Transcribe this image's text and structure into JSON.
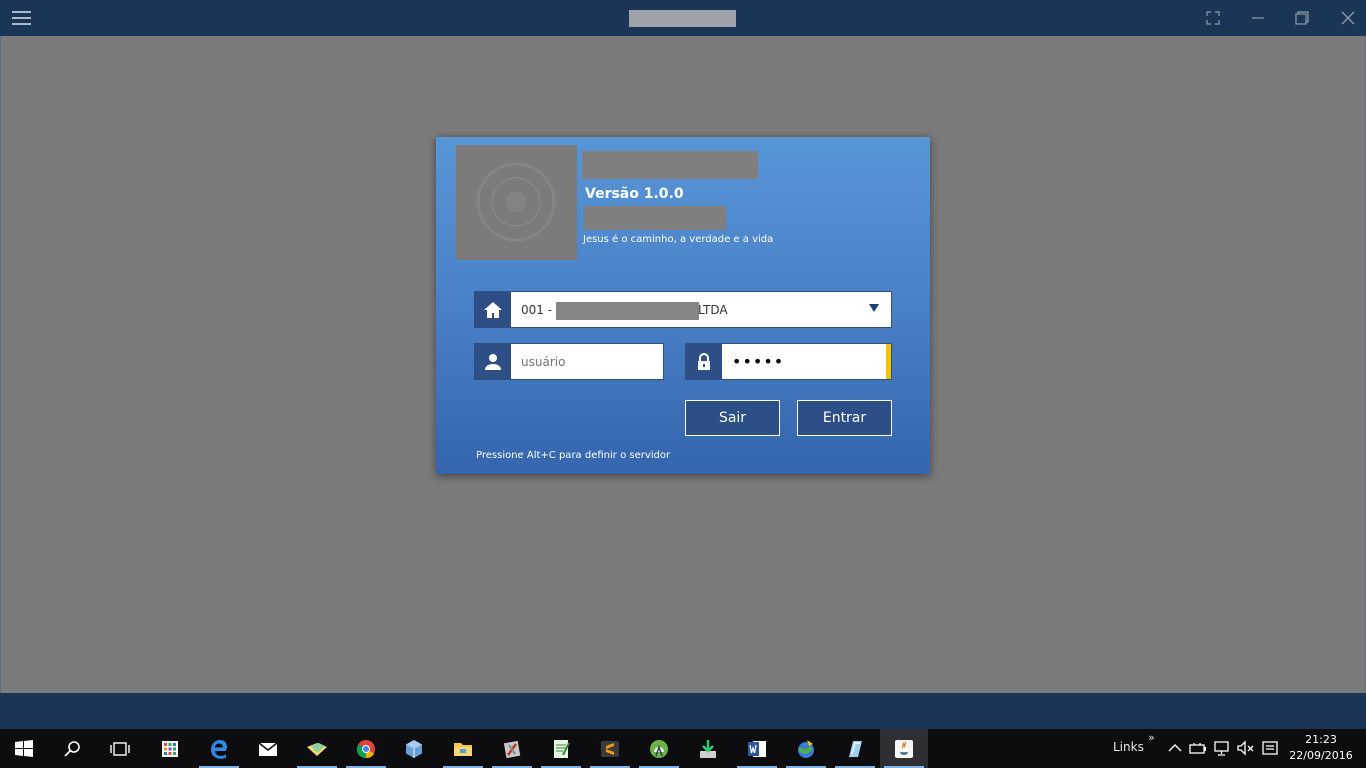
{
  "window": {
    "menu_icon": "hamburger-menu-icon",
    "controls": [
      "fullscreen-icon",
      "minimize-icon",
      "restore-icon",
      "close-icon"
    ]
  },
  "login": {
    "version": "Versão 1.0.0",
    "motto": "Jesus é o caminho, a verdade e a vida",
    "company_prefix": "001 -",
    "company_suffix": "LTDA",
    "user_placeholder": "usuário",
    "password_value": "•••••",
    "exit_label": "Sair",
    "enter_label": "Entrar",
    "hint": "Pressione Alt+C para definir o servidor"
  },
  "taskbar": {
    "apps": [
      "start",
      "search",
      "task-view",
      "store",
      "edge",
      "mail",
      "explorer-stack",
      "chrome",
      "virtualbox",
      "file-explorer",
      "tools",
      "notepad",
      "sublime",
      "android-studio",
      "downloader",
      "word",
      "network-app",
      "cloud-app",
      "java"
    ],
    "links_label": "Links",
    "chevron": "»",
    "time": "21:23",
    "date": "22/09/2016"
  },
  "colors": {
    "titlebar": "#1b3556",
    "dialog_top": "#5796d7",
    "dialog_bottom": "#3465ae",
    "icon_bg": "#2d4f86",
    "focus_accent": "#f2c300"
  }
}
